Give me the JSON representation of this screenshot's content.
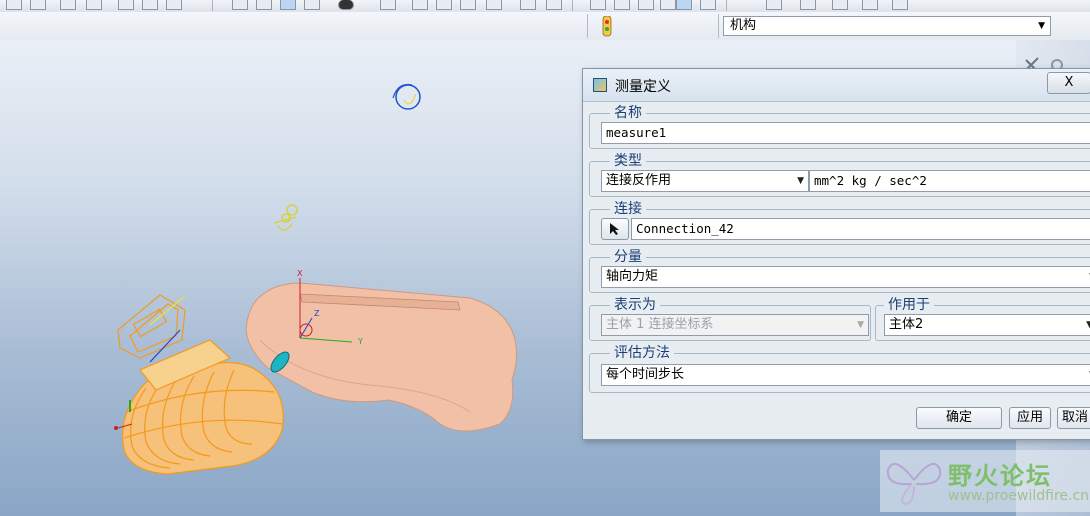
{
  "toolbar": {
    "mechanism_select": "机构"
  },
  "dialog": {
    "title": "测量定义",
    "close_label": "X",
    "name_group": {
      "legend": "名称",
      "value": "measure1"
    },
    "type_group": {
      "legend": "类型",
      "type_value": "连接反作用",
      "unit": "mm^2 kg / sec^2"
    },
    "connection_group": {
      "legend": "连接",
      "value": "Connection_42"
    },
    "component_group": {
      "legend": "分量",
      "value": "轴向力矩"
    },
    "express_group": {
      "legend": "表示为",
      "value": "主体 1 连接坐标系"
    },
    "apply_to_group": {
      "legend": "作用于",
      "value": "主体2"
    },
    "evaluation_group": {
      "legend": "评估方法",
      "value": "每个时间步长"
    },
    "buttons": {
      "ok": "确定",
      "apply": "应用",
      "cancel": "取消"
    }
  },
  "watermark": {
    "name": "野火论坛",
    "url": "www.proewildfire.cn"
  },
  "colors": {
    "body_fill": "#f2c0a6",
    "highlight": "#f39a1d",
    "dialog_bg": "#e8edf2",
    "legend_text": "#1b3f77"
  }
}
